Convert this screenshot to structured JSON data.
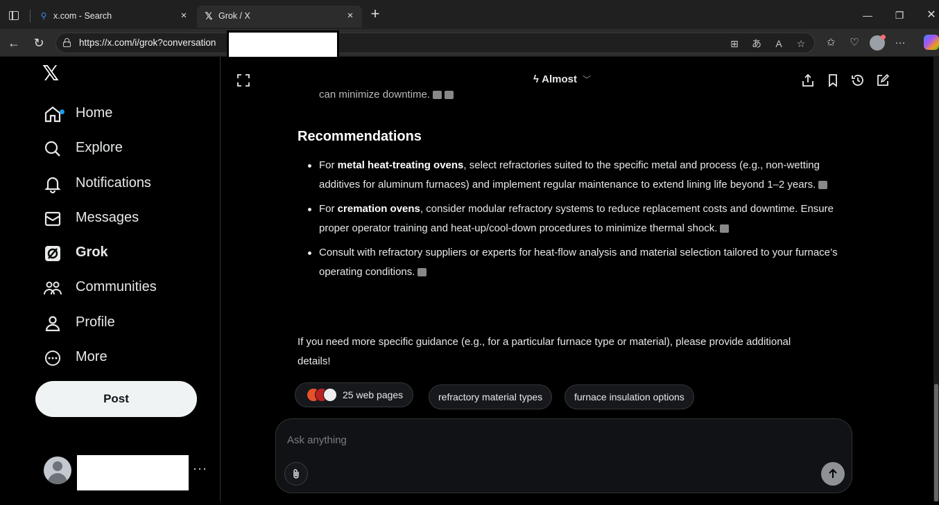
{
  "browser": {
    "tabs": [
      {
        "title": "x.com - Search",
        "icon": "search-icon"
      },
      {
        "title": "Grok / X",
        "icon": "x-logo-icon"
      }
    ],
    "url": "https://x.com/i/grok?conversation"
  },
  "sidebar": {
    "items": [
      {
        "label": "Home",
        "icon": "home-icon"
      },
      {
        "label": "Explore",
        "icon": "search-icon"
      },
      {
        "label": "Notifications",
        "icon": "bell-icon"
      },
      {
        "label": "Messages",
        "icon": "mail-icon"
      },
      {
        "label": "Grok",
        "icon": "grok-icon"
      },
      {
        "label": "Communities",
        "icon": "people-icon"
      },
      {
        "label": "Profile",
        "icon": "person-icon"
      },
      {
        "label": "More",
        "icon": "more-circle-icon"
      }
    ],
    "post_label": "Post",
    "more_glyph": "···"
  },
  "header": {
    "model": "Almost"
  },
  "message": {
    "fade_line": "can minimize downtime.",
    "heading": "Recommendations",
    "recommendations": [
      {
        "prefix": "For ",
        "bold": "metal heat-treating ovens",
        "rest": ", select refractories suited to the specific metal and process (e.g., non-wetting additives for aluminum furnaces) and implement regular maintenance to extend lining life beyond 1–2 years."
      },
      {
        "prefix": "For ",
        "bold": "cremation ovens",
        "rest": ", consider modular refractory systems to reduce replacement costs and downtime. Ensure proper operator training and heat-up/cool-down procedures to minimize thermal shock."
      },
      {
        "prefix": "",
        "bold": "",
        "rest": "Consult with refractory suppliers or experts for heat-flow analysis and material selection tailored to your furnace’s operating conditions."
      }
    ],
    "closing": "If you need more specific guidance (e.g., for a particular furnace type or material), please provide additional details!"
  },
  "chips": {
    "sources": "25 web pages",
    "suggestions": [
      "refractory material types",
      "furnace insulation options"
    ]
  },
  "composer": {
    "placeholder": "Ask anything"
  },
  "colors": {
    "accent": "#1d9bf0",
    "post_button": "#eff3f4",
    "background": "#000000"
  }
}
